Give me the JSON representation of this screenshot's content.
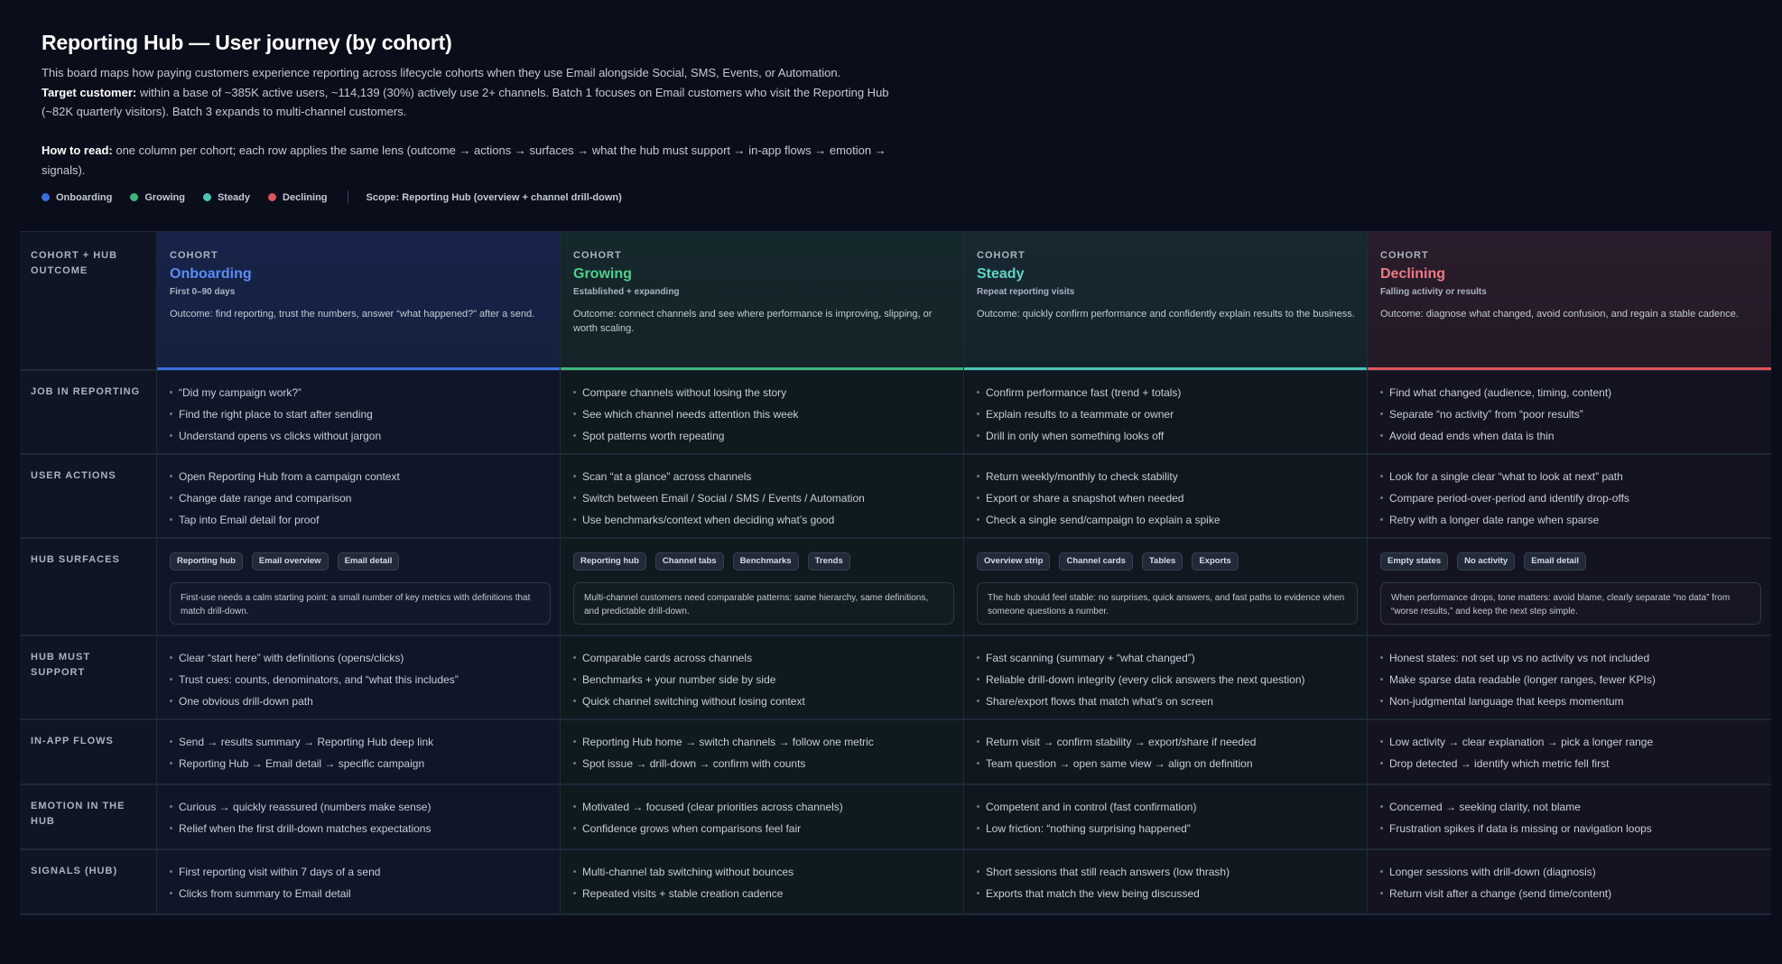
{
  "header": {
    "title": "Reporting Hub — User journey (by cohort)",
    "intro_line1": "This board maps how paying customers experience reporting across lifecycle cohorts when they use Email alongside Social, SMS, Events, or Automation.",
    "target_label": "Target customer:",
    "target_text": " within a base of ~385K active users, ~114,139 (30%) actively use 2+ channels. Batch 1 focuses on Email customers who visit the Reporting Hub (~82K quarterly visitors). Batch 3 expands to multi-channel customers.",
    "howto_label": "How to read:",
    "howto_text": " one column per cohort; each row applies the same lens (outcome → actions → surfaces → what the hub must support → in-app flows → emotion → signals)."
  },
  "legend": {
    "items": [
      {
        "label": "Onboarding",
        "color": "#3b6fe0"
      },
      {
        "label": "Growing",
        "color": "#3fb57c"
      },
      {
        "label": "Steady",
        "color": "#4cc4b4"
      },
      {
        "label": "Declining",
        "color": "#e0545e"
      }
    ],
    "scope": "Scope: Reporting Hub (overview + channel drill-down)"
  },
  "row_labels": {
    "header": "Cohort + hub outcome",
    "job": "Job in reporting",
    "actions": "User actions",
    "surfaces": "Hub surfaces",
    "support": "Hub must support",
    "flows": "In-app flows",
    "emotion": "Emotion in the hub",
    "signals": "Signals (hub)"
  },
  "cohorts": [
    {
      "kicker": "COHORT",
      "name": "Onboarding",
      "color": "#5b8cf5",
      "accent": "#3b6fe0",
      "sub": "First 0–90 days",
      "outcome": "Outcome: find reporting, trust the numbers, answer “what happened?” after a send.",
      "job": [
        "“Did my campaign work?”",
        "Find the right place to start after sending",
        "Understand opens vs clicks without jargon"
      ],
      "actions": [
        "Open Reporting Hub from a campaign context",
        "Change date range and comparison",
        "Tap into Email detail for proof"
      ],
      "chips": [
        "Reporting hub",
        "Email overview",
        "Email detail"
      ],
      "note": "First-use needs a calm starting point: a small number of key metrics with definitions that match drill-down.",
      "support": [
        "Clear “start here” with definitions (opens/clicks)",
        "Trust cues: counts, denominators, and “what this includes”",
        "One obvious drill-down path"
      ],
      "flows": [
        "Send → results summary → Reporting Hub deep link",
        "Reporting Hub → Email detail → specific campaign"
      ],
      "emotion": [
        "Curious → quickly reassured (numbers make sense)",
        "Relief when the first drill-down matches expectations"
      ],
      "signals": [
        "First reporting visit within 7 days of a send",
        "Clicks from summary to Email detail"
      ]
    },
    {
      "kicker": "COHORT",
      "name": "Growing",
      "color": "#4fcf8a",
      "accent": "#3fb57c",
      "sub": "Established + expanding",
      "outcome": "Outcome: connect channels and see where performance is improving, slipping, or worth scaling.",
      "job": [
        "Compare channels without losing the story",
        "See which channel needs attention this week",
        "Spot patterns worth repeating"
      ],
      "actions": [
        "Scan “at a glance” across channels",
        "Switch between Email / Social / SMS / Events / Automation",
        "Use benchmarks/context when deciding what’s good"
      ],
      "chips": [
        "Reporting hub",
        "Channel tabs",
        "Benchmarks",
        "Trends"
      ],
      "note": "Multi-channel customers need comparable patterns: same hierarchy, same definitions, and predictable drill-down.",
      "support": [
        "Comparable cards across channels",
        "Benchmarks + your number side by side",
        "Quick channel switching without losing context"
      ],
      "flows": [
        "Reporting Hub home → switch channels → follow one metric",
        "Spot issue → drill-down → confirm with counts"
      ],
      "emotion": [
        "Motivated → focused (clear priorities across channels)",
        "Confidence grows when comparisons feel fair"
      ],
      "signals": [
        "Multi-channel tab switching without bounces",
        "Repeated visits + stable creation cadence"
      ]
    },
    {
      "kicker": "COHORT",
      "name": "Steady",
      "color": "#5fd6c4",
      "accent": "#4cc4b4",
      "sub": "Repeat reporting visits",
      "outcome": "Outcome: quickly confirm performance and confidently explain results to the business.",
      "job": [
        "Confirm performance fast (trend + totals)",
        "Explain results to a teammate or owner",
        "Drill in only when something looks off"
      ],
      "actions": [
        "Return weekly/monthly to check stability",
        "Export or share a snapshot when needed",
        "Check a single send/campaign to explain a spike"
      ],
      "chips": [
        "Overview strip",
        "Channel cards",
        "Tables",
        "Exports"
      ],
      "note": "The hub should feel stable: no surprises, quick answers, and fast paths to evidence when someone questions a number.",
      "support": [
        "Fast scanning (summary + “what changed”)",
        "Reliable drill-down integrity (every click answers the next question)",
        "Share/export flows that match what’s on screen"
      ],
      "flows": [
        "Return visit → confirm stability → export/share if needed",
        "Team question → open same view → align on definition"
      ],
      "emotion": [
        "Competent and in control (fast confirmation)",
        "Low friction: “nothing surprising happened”"
      ],
      "signals": [
        "Short sessions that still reach answers (low thrash)",
        "Exports that match the view being discussed"
      ]
    },
    {
      "kicker": "COHORT",
      "name": "Declining",
      "color": "#f07a84",
      "accent": "#e0545e",
      "sub": "Falling activity or results",
      "outcome": "Outcome: diagnose what changed, avoid confusion, and regain a stable cadence.",
      "job": [
        "Find what changed (audience, timing, content)",
        "Separate “no activity” from “poor results”",
        "Avoid dead ends when data is thin"
      ],
      "actions": [
        "Look for a single clear “what to look at next” path",
        "Compare period-over-period and identify drop-offs",
        "Retry with a longer date range when sparse"
      ],
      "chips": [
        "Empty states",
        "No activity",
        "Email detail"
      ],
      "note": "When performance drops, tone matters: avoid blame, clearly separate “no data” from “worse results,” and keep the next step simple.",
      "support": [
        "Honest states: not set up vs no activity vs not included",
        "Make sparse data readable (longer ranges, fewer KPIs)",
        "Non-judgmental language that keeps momentum"
      ],
      "flows": [
        "Low activity → clear explanation → pick a longer range",
        "Drop detected → identify which metric fell first"
      ],
      "emotion": [
        "Concerned → seeking clarity, not blame",
        "Frustration spikes if data is missing or navigation loops"
      ],
      "signals": [
        "Longer sessions with drill-down (diagnosis)",
        "Return visit after a change (send time/content)"
      ]
    }
  ]
}
